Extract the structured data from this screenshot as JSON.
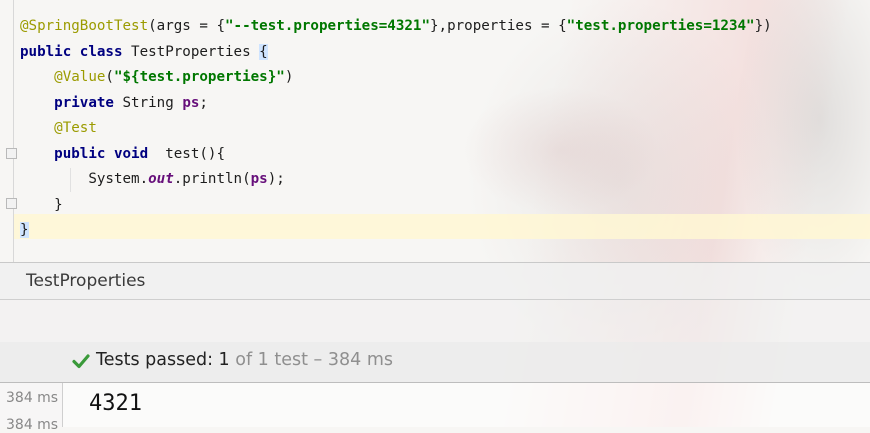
{
  "editor": {
    "lines": [
      {
        "parts": [
          {
            "t": "@SpringBootTest",
            "c": "ann"
          },
          {
            "t": "(args = {",
            "c": ""
          },
          {
            "t": "\"--test.properties=4321\"",
            "c": "str"
          },
          {
            "t": "},properties = {",
            "c": ""
          },
          {
            "t": "\"test.properties=1234\"",
            "c": "str"
          },
          {
            "t": "})",
            "c": ""
          }
        ]
      },
      {
        "parts": [
          {
            "t": "public class ",
            "c": "kw"
          },
          {
            "t": "TestProperties ",
            "c": ""
          },
          {
            "t": "{",
            "c": "brace-hl"
          }
        ]
      },
      {
        "parts": [
          {
            "t": "    ",
            "c": ""
          },
          {
            "t": "@Value",
            "c": "ann"
          },
          {
            "t": "(",
            "c": ""
          },
          {
            "t": "\"${test.properties}\"",
            "c": "str"
          },
          {
            "t": ")",
            "c": ""
          }
        ]
      },
      {
        "parts": [
          {
            "t": "    ",
            "c": ""
          },
          {
            "t": "private ",
            "c": "kw"
          },
          {
            "t": "String ",
            "c": ""
          },
          {
            "t": "ps",
            "c": "field"
          },
          {
            "t": ";",
            "c": ""
          }
        ]
      },
      {
        "parts": [
          {
            "t": "    ",
            "c": ""
          },
          {
            "t": "@Test",
            "c": "ann"
          }
        ]
      },
      {
        "parts": [
          {
            "t": "    ",
            "c": ""
          },
          {
            "t": "public void ",
            "c": "kw"
          },
          {
            "t": " test(){",
            "c": ""
          }
        ]
      },
      {
        "parts": [
          {
            "t": "        System.",
            "c": ""
          },
          {
            "t": "out",
            "c": "ital"
          },
          {
            "t": ".println(",
            "c": ""
          },
          {
            "t": "ps",
            "c": "field"
          },
          {
            "t": ");",
            "c": ""
          }
        ]
      },
      {
        "parts": [
          {
            "t": "    }",
            "c": ""
          }
        ]
      },
      {
        "parts": [
          {
            "t": "}",
            "c": "brace-hl"
          }
        ]
      }
    ]
  },
  "run_panel": {
    "title": "TestProperties",
    "status_main": "Tests passed: ",
    "status_count": "1",
    "status_muted": " of 1 test – 384 ms",
    "tree_times": [
      "384 ms",
      "384 ms"
    ],
    "console_output": "4321"
  },
  "colors": {
    "annotation": "#9b9b00",
    "keyword": "#000080",
    "string": "#007700",
    "field": "#660e7a",
    "pass_green": "#3a9a3a"
  }
}
